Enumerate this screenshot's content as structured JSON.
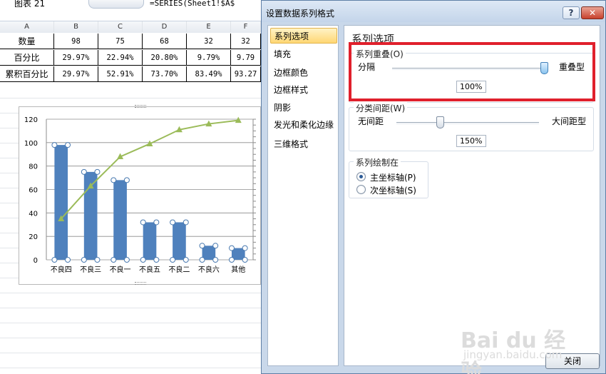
{
  "sheet": {
    "namebox": "图表 21",
    "formula": "=SERIES(Sheet1!$A$",
    "columns": [
      "A",
      "B",
      "C",
      "D",
      "E",
      "F"
    ],
    "rows": [
      {
        "label": "数量",
        "values": [
          "98",
          "75",
          "68",
          "32",
          "32"
        ]
      },
      {
        "label": "百分比",
        "values": [
          "29.97%",
          "22.94%",
          "20.80%",
          "9.79%",
          "9.79"
        ]
      },
      {
        "label": "累积百分比",
        "values": [
          "29.97%",
          "52.91%",
          "73.70%",
          "83.49%",
          "93.27"
        ]
      }
    ]
  },
  "chart_data": {
    "type": "bar",
    "categories": [
      "不良四",
      "不良三",
      "不良一",
      "不良五",
      "不良二",
      "不良六",
      "其他"
    ],
    "series": [
      {
        "type": "bar",
        "values": [
          98,
          75,
          68,
          32,
          32,
          12,
          10
        ],
        "color": "#4f81bd"
      },
      {
        "type": "line",
        "values": [
          35,
          63,
          88,
          99,
          111,
          116,
          119
        ],
        "color": "#9bbb59",
        "marker": "triangle"
      }
    ],
    "ylim": [
      0,
      120
    ],
    "yticks": [
      0,
      20,
      40,
      60,
      80,
      100,
      120
    ],
    "secondary_axis": "right",
    "grid": true
  },
  "dialog": {
    "title": "设置数据系列格式",
    "help_label": "?",
    "close_label": "✕",
    "nav": [
      "系列选项",
      "填充",
      "边框颜色",
      "边框样式",
      "阴影",
      "发光和柔化边缘",
      "三维格式"
    ],
    "selected_nav": 0,
    "panel_title": "系列选项",
    "overlap": {
      "label": "系列重叠(O)",
      "left": "分隔",
      "right": "重叠型",
      "value": "100%",
      "level": 1.0
    },
    "gap": {
      "label": "分类间距(W)",
      "left": "无间距",
      "right": "大间距型",
      "value": "150%",
      "level": 0.3
    },
    "plot_on": {
      "label": "系列绘制在",
      "primary": "主坐标轴(P)",
      "secondary": "次坐标轴(S)",
      "selected": "primary"
    },
    "close_button": "关闭"
  },
  "watermark": {
    "main": "Bai du 经验",
    "sub": "jingyan.baidu.com"
  }
}
